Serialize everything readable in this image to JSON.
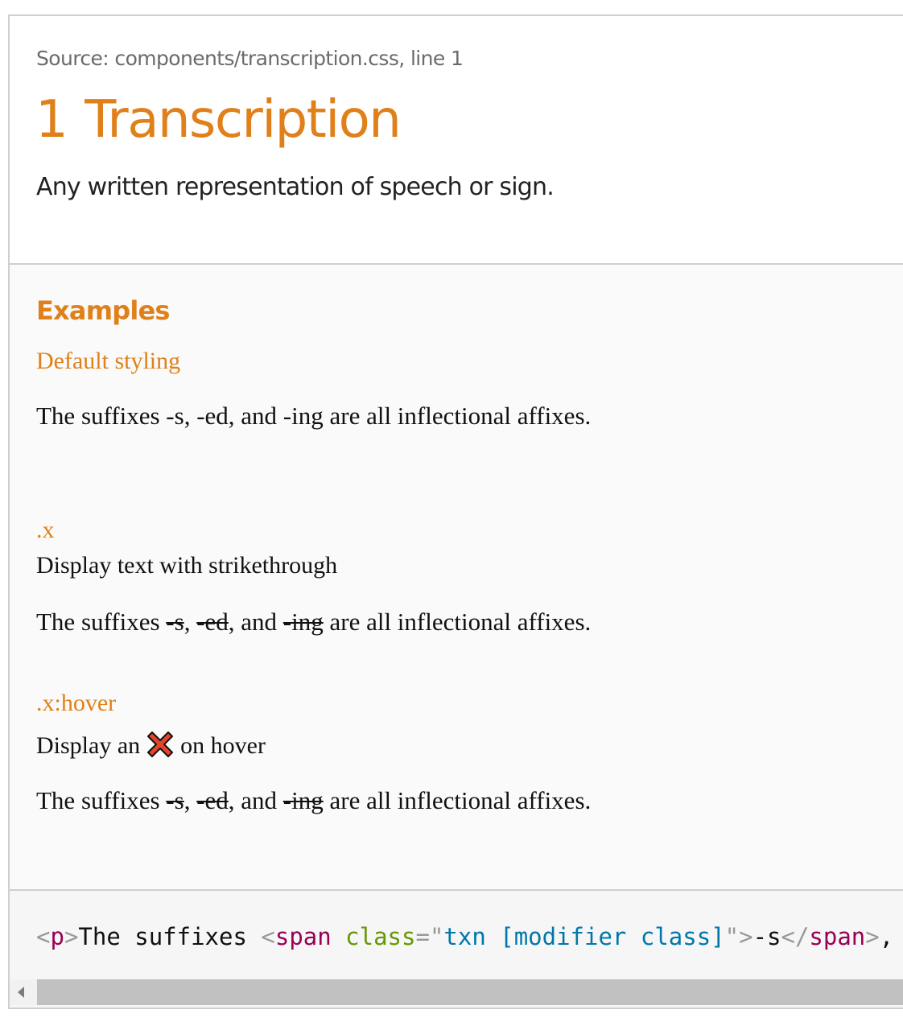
{
  "header": {
    "source": "Source: components/transcription.css, line 1",
    "section_number": "1",
    "title": "Transcription",
    "description": "Any written representation of speech or sign."
  },
  "examples": {
    "heading": "Examples",
    "default": {
      "label": "Default styling",
      "line": {
        "part1": "The suffixes ",
        "s": "-s",
        "sep1": ", ",
        "ed": "-ed",
        "sep2": ", and ",
        "ing": "-ing",
        "part2": " are all inflectional affixes."
      }
    },
    "x": {
      "label": ".x",
      "description": "Display text with strikethrough",
      "line": {
        "part1": "The suffixes ",
        "s": "-s",
        "sep1": ", ",
        "ed": "-ed",
        "sep2": ", and ",
        "ing": "-ing",
        "part2": " are all inflectional affixes."
      }
    },
    "x_hover": {
      "label": ".x:hover",
      "description_before": "Display an",
      "description_after": "on hover",
      "icon": "cross-mark-icon",
      "line": {
        "part1": "The suffixes ",
        "s": "-s",
        "sep1": ", ",
        "ed": "-ed",
        "sep2": ", and ",
        "ing": "-ing",
        "part2": " are all inflectional affixes."
      }
    }
  },
  "code": {
    "t1": "<",
    "t2": "p",
    "t3": ">",
    "t4": "The suffixes ",
    "t5": "<",
    "t6": "span",
    "t7": " ",
    "t8": "class",
    "t9": "=",
    "t10": "\"",
    "t11": "txn [modifier class]",
    "t12": "\"",
    "t13": ">",
    "t14": "-s",
    "t15": "</",
    "t16": "span",
    "t17": ">",
    "t18": ","
  },
  "colors": {
    "accent": "#e0801a",
    "code_tag": "#990055",
    "code_attr": "#669900",
    "code_value": "#0077aa",
    "code_punct": "#999999",
    "icon_fill": "#e2452b"
  }
}
